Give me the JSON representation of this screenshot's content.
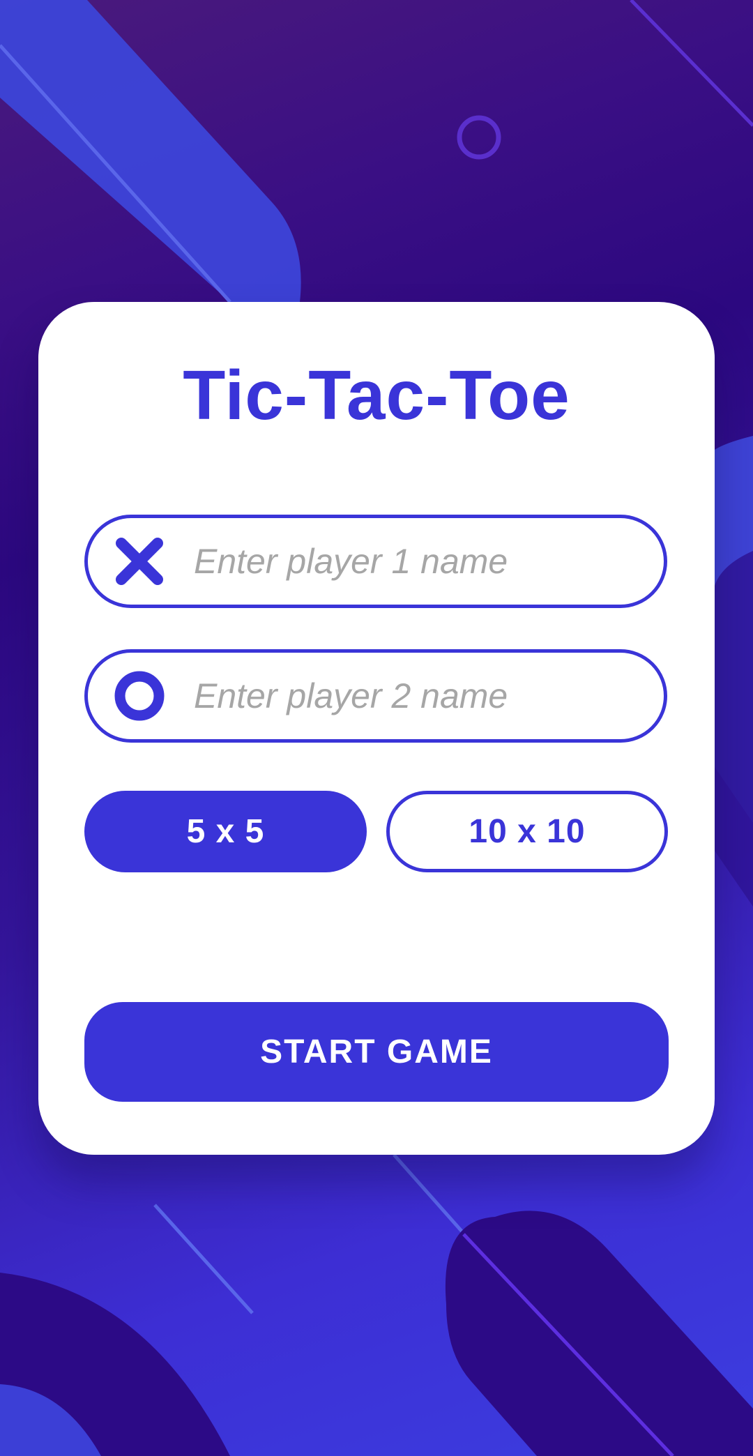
{
  "app": {
    "title": "Tic-Tac-Toe"
  },
  "players": {
    "player1": {
      "placeholder": "Enter player 1 name",
      "value": "",
      "icon": "x-icon"
    },
    "player2": {
      "placeholder": "Enter player 2 name",
      "value": "",
      "icon": "o-icon"
    }
  },
  "board_size": {
    "options": [
      "5 x 5",
      "10 x 10"
    ],
    "selected": "5 x 5"
  },
  "actions": {
    "start_label": "START GAME"
  },
  "colors": {
    "accent": "#3a34d8",
    "placeholder": "#a6a6a6",
    "card": "#ffffff",
    "background_top": "#4a1a7c",
    "background_bottom": "#3b3ee0"
  }
}
